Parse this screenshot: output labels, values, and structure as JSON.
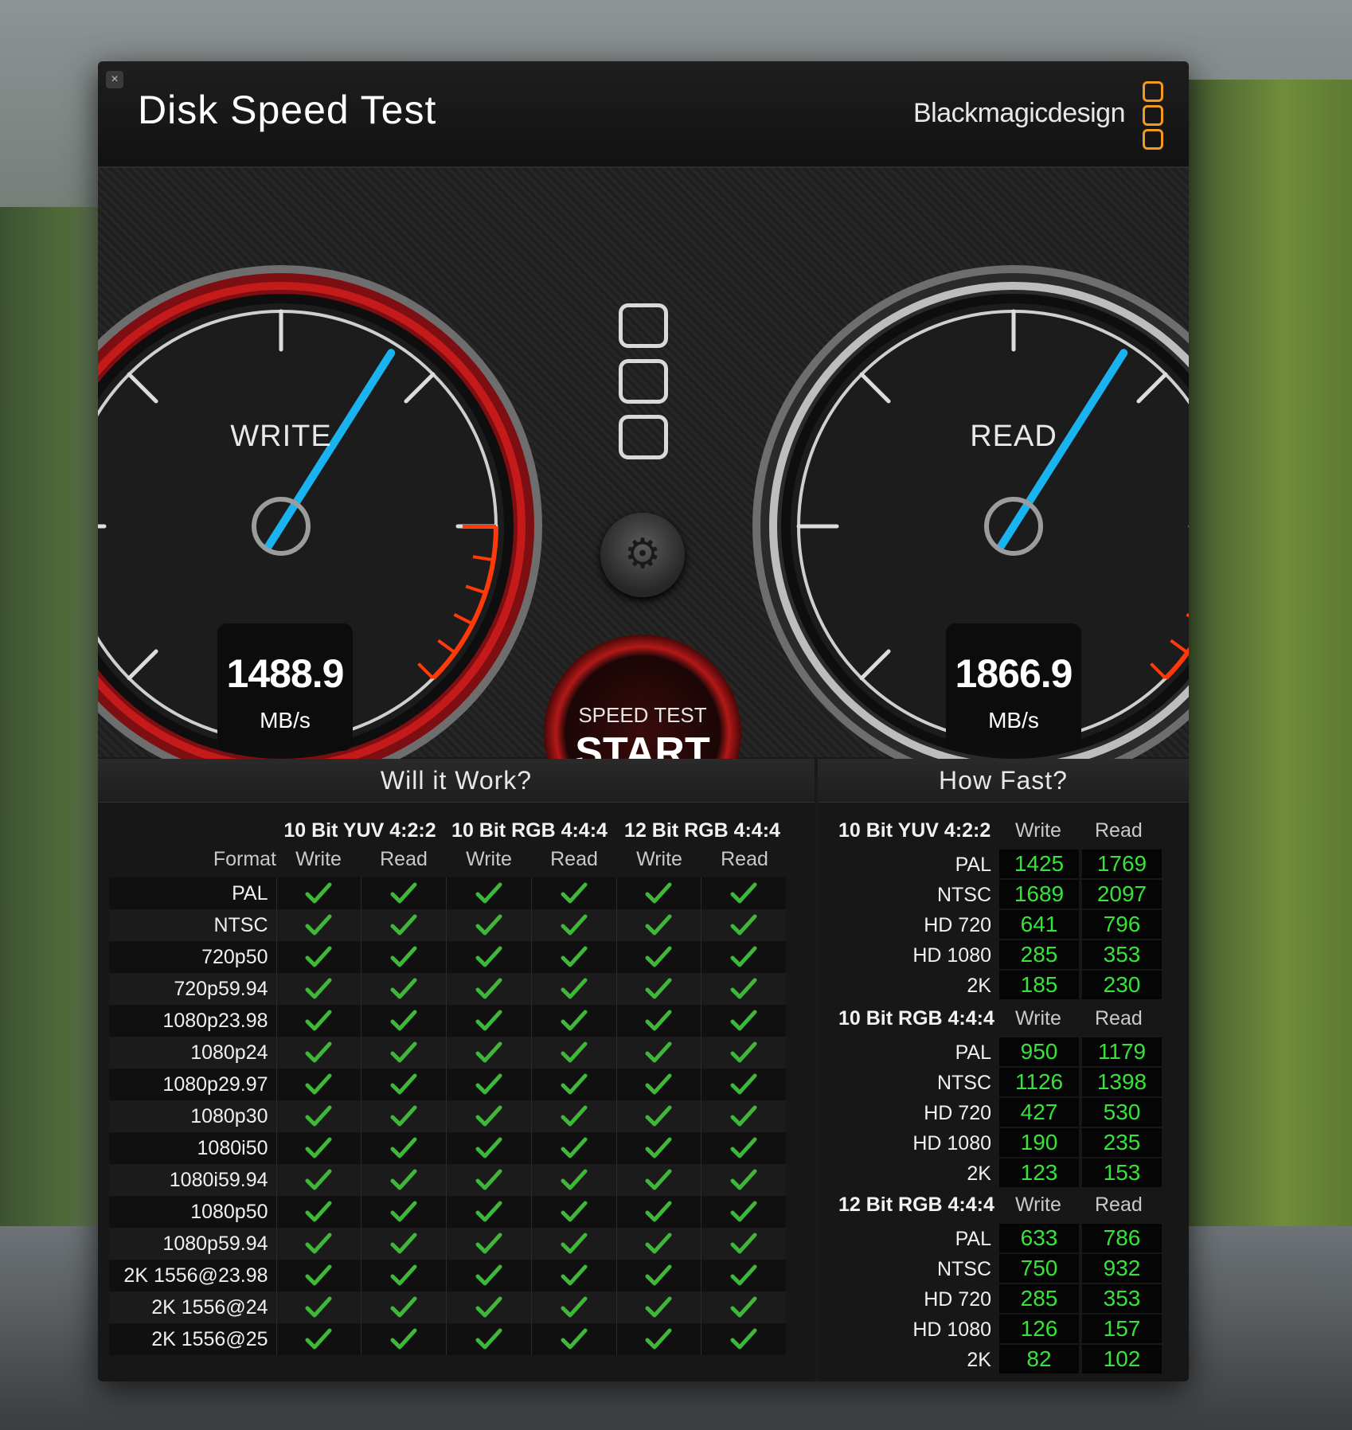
{
  "window": {
    "title": "Disk Speed Test",
    "brand": "Blackmagicdesign",
    "close_icon": "close-icon"
  },
  "gauges": {
    "write": {
      "label": "WRITE",
      "value": "1488.9",
      "unit": "MB/s",
      "level": 0.62,
      "ring_color": "#c51a1a"
    },
    "read": {
      "label": "READ",
      "value": "1866.9",
      "unit": "MB/s",
      "level": 0.62,
      "ring_color": "#9a9a9a"
    },
    "needle_color": "#19b3f0",
    "redline_color": "#ff3a0a"
  },
  "start_button": {
    "small": "SPEED TEST",
    "big": "START"
  },
  "settings_button": {
    "icon": "gear-icon"
  },
  "will_it_work": {
    "title": "Will it Work?",
    "format_label": "Format",
    "groups": [
      "10 Bit YUV 4:2:2",
      "10 Bit RGB 4:4:4",
      "12 Bit RGB 4:4:4"
    ],
    "subheads": [
      "Write",
      "Read",
      "Write",
      "Read",
      "Write",
      "Read"
    ],
    "formats": [
      "PAL",
      "NTSC",
      "720p50",
      "720p59.94",
      "1080p23.98",
      "1080p24",
      "1080p29.97",
      "1080p30",
      "1080i50",
      "1080i59.94",
      "1080p50",
      "1080p59.94",
      "2K 1556@23.98",
      "2K 1556@24",
      "2K 1556@25"
    ],
    "check_icon": "checkmark-icon",
    "check_color": "#3fb83a"
  },
  "how_fast": {
    "title": "How Fast?",
    "groups": [
      {
        "name": "10 Bit YUV 4:2:2",
        "write_label": "Write",
        "read_label": "Read",
        "rows": [
          {
            "format": "PAL",
            "write": "1425",
            "read": "1769"
          },
          {
            "format": "NTSC",
            "write": "1689",
            "read": "2097"
          },
          {
            "format": "HD 720",
            "write": "641",
            "read": "796"
          },
          {
            "format": "HD 1080",
            "write": "285",
            "read": "353"
          },
          {
            "format": "2K",
            "write": "185",
            "read": "230"
          }
        ]
      },
      {
        "name": "10 Bit RGB 4:4:4",
        "write_label": "Write",
        "read_label": "Read",
        "rows": [
          {
            "format": "PAL",
            "write": "950",
            "read": "1179"
          },
          {
            "format": "NTSC",
            "write": "1126",
            "read": "1398"
          },
          {
            "format": "HD 720",
            "write": "427",
            "read": "530"
          },
          {
            "format": "HD 1080",
            "write": "190",
            "read": "235"
          },
          {
            "format": "2K",
            "write": "123",
            "read": "153"
          }
        ]
      },
      {
        "name": "12 Bit RGB 4:4:4",
        "write_label": "Write",
        "read_label": "Read",
        "rows": [
          {
            "format": "PAL",
            "write": "633",
            "read": "786"
          },
          {
            "format": "NTSC",
            "write": "750",
            "read": "932"
          },
          {
            "format": "HD 720",
            "write": "285",
            "read": "353"
          },
          {
            "format": "HD 1080",
            "write": "126",
            "read": "157"
          },
          {
            "format": "2K",
            "write": "82",
            "read": "102"
          }
        ]
      }
    ]
  }
}
